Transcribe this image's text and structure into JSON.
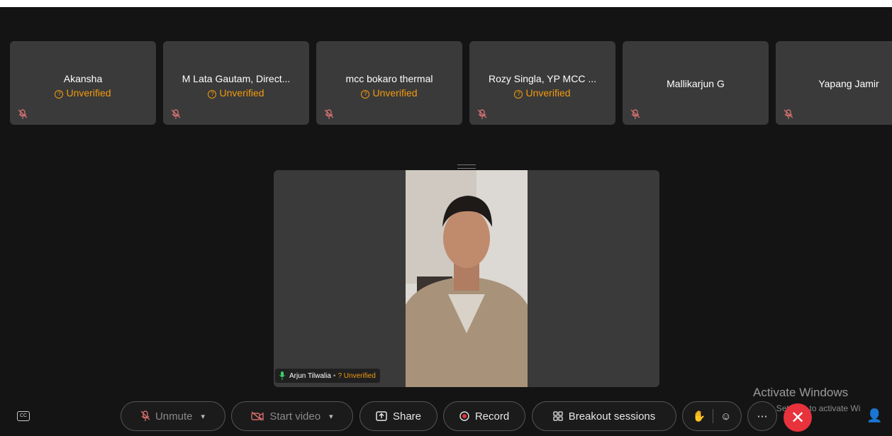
{
  "participants": [
    {
      "name": "Akansha",
      "status": "Unverified"
    },
    {
      "name": "M Lata Gautam, Direct...",
      "status": "Unverified"
    },
    {
      "name": "mcc bokaro thermal",
      "status": "Unverified"
    },
    {
      "name": "Rozy Singla, YP MCC ...",
      "status": "Unverified"
    },
    {
      "name": "Mallikarjun G",
      "status": ""
    },
    {
      "name": "Yapang Jamir",
      "status": ""
    }
  ],
  "main_speaker": {
    "name": "Arjun Tilwalia",
    "status": "Unverified"
  },
  "watermark": {
    "line1": "Activate Windows",
    "line2": "Go to Settings to activate Wi"
  },
  "toolbar": {
    "unmute": "Unmute",
    "start_video": "Start video",
    "share": "Share",
    "record": "Record",
    "breakout": "Breakout sessions"
  },
  "colors": {
    "accent_unverified": "#f29a0f",
    "end_call": "#e8333c"
  }
}
